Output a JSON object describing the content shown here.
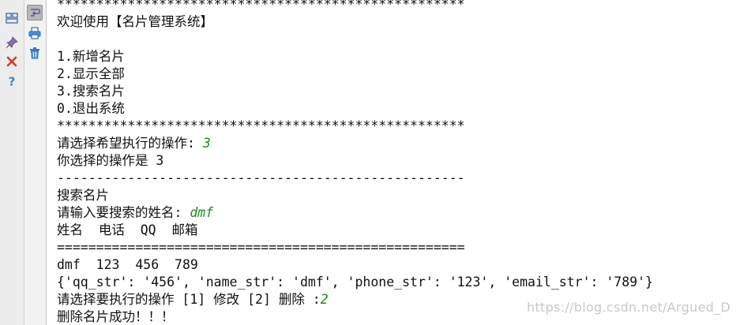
{
  "colors": {
    "console_text": "#111111",
    "user_input": "#1e8a1e",
    "toolbar_bg": "#f2f2f2",
    "active_tool": "#b7b7b7"
  },
  "toolbar": {
    "icons": [
      "layout-icon",
      "pin-icon",
      "close-icon",
      "help-icon",
      "softwrap-icon",
      "print-icon",
      "trash-icon"
    ]
  },
  "console": {
    "lines": [
      {
        "text": "****************************************************"
      },
      {
        "text": "欢迎使用【名片管理系统】"
      },
      {
        "text": ""
      },
      {
        "text": "1.新增名片"
      },
      {
        "text": "2.显示全部"
      },
      {
        "text": "3.搜索名片"
      },
      {
        "text": "0.退出系统"
      },
      {
        "text": "****************************************************"
      },
      {
        "text": "请选择希望执行的操作: ",
        "input": "3"
      },
      {
        "text": "你选择的操作是 3"
      },
      {
        "text": "----------------------------------------------------"
      },
      {
        "text": "搜索名片"
      },
      {
        "text": "请输入要搜索的姓名: ",
        "input": "dmf"
      },
      {
        "text": "姓名  电话  QQ  邮箱"
      },
      {
        "text": "===================================================="
      },
      {
        "text": "dmf  123  456  789"
      },
      {
        "text": "{'qq_str': '456', 'name_str': 'dmf', 'phone_str': '123', 'email_str': '789'}"
      },
      {
        "text": "请选择要执行的操作 [1] 修改 [2] 删除 :",
        "input": "2"
      },
      {
        "text": "删除名片成功！！！"
      }
    ]
  },
  "watermark": "https://blog.csdn.net/Argued_D"
}
